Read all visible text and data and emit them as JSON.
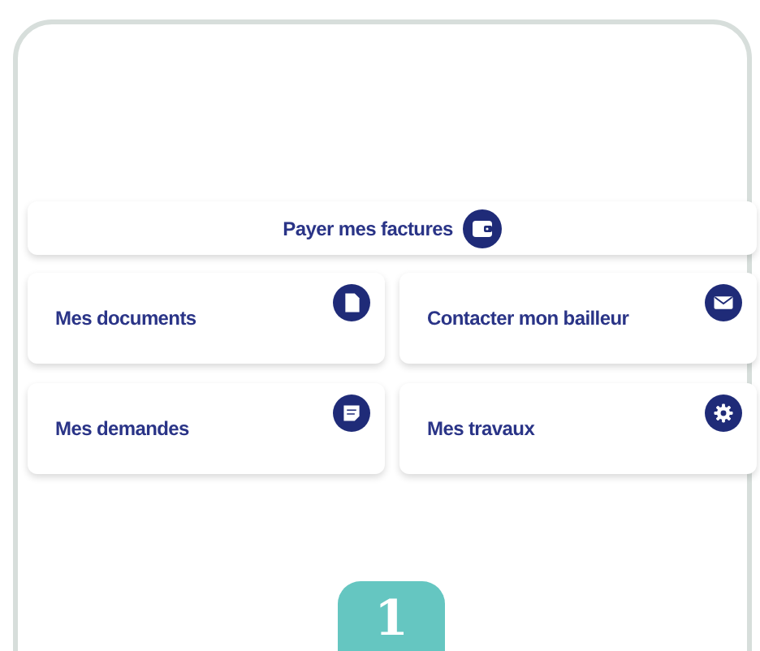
{
  "pay_button": {
    "label": "Payer mes factures"
  },
  "tiles": [
    {
      "label": "Mes documents",
      "kind": "document"
    },
    {
      "label": "Contacter mon bailleur",
      "kind": "mail"
    },
    {
      "label": "Mes demandes",
      "kind": "note"
    },
    {
      "label": "Mes travaux",
      "kind": "gear"
    }
  ],
  "step_badge": "1"
}
